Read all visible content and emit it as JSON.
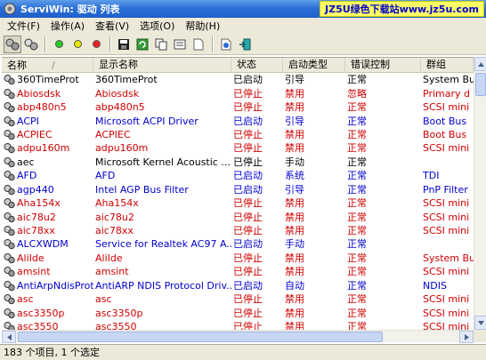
{
  "window": {
    "title": "ServiWin: 驱动 列表",
    "watermark": "JZ5U绿色下载站www.jz5u.com"
  },
  "menu": [
    "文件(F)",
    "操作(A)",
    "查看(V)",
    "选项(O)",
    "帮助(H)"
  ],
  "toolbar": {
    "buttons": [
      {
        "name": "drivers-view-icon",
        "pressed": true
      },
      {
        "name": "services-view-icon",
        "pressed": false
      },
      {
        "name": "sep"
      },
      {
        "name": "start-green-icon",
        "color": "#22cc22"
      },
      {
        "name": "pause-yellow-icon",
        "color": "#e8e800"
      },
      {
        "name": "stop-red-icon",
        "color": "#ee2222"
      },
      {
        "name": "sep"
      },
      {
        "name": "save-icon"
      },
      {
        "name": "refresh-icon"
      },
      {
        "name": "copy-icon"
      },
      {
        "name": "properties-icon"
      },
      {
        "name": "blank-page-icon"
      },
      {
        "name": "sep"
      },
      {
        "name": "html-report-icon"
      },
      {
        "name": "exit-icon"
      }
    ]
  },
  "columns": [
    "名称",
    "显示名称",
    "状态",
    "启动类型",
    "错误控制",
    "群组"
  ],
  "colors": {
    "red": "#d00000",
    "blue": "#0000d0",
    "black": "#000000"
  },
  "rows": [
    {
      "name": "360TimeProt",
      "display": "360TimeProt",
      "status": "已启动",
      "start": "引导",
      "error": "正常",
      "group": "System Bu",
      "color": "black"
    },
    {
      "name": "Abiosdsk",
      "display": "Abiosdsk",
      "status": "已停止",
      "start": "禁用",
      "error": "忽略",
      "group": "Primary d",
      "color": "red"
    },
    {
      "name": "abp480n5",
      "display": "abp480n5",
      "status": "已停止",
      "start": "禁用",
      "error": "正常",
      "group": "SCSI mini",
      "color": "red"
    },
    {
      "name": "ACPI",
      "display": "Microsoft ACPI Driver",
      "status": "已启动",
      "start": "引导",
      "error": "正常",
      "group": "Boot Bus",
      "color": "blue"
    },
    {
      "name": "ACPIEC",
      "display": "ACPIEC",
      "status": "已停止",
      "start": "禁用",
      "error": "正常",
      "group": "Boot Bus",
      "color": "red"
    },
    {
      "name": "adpu160m",
      "display": "adpu160m",
      "status": "已停止",
      "start": "禁用",
      "error": "正常",
      "group": "SCSI mini",
      "color": "red"
    },
    {
      "name": "aec",
      "display": "Microsoft Kernel Acoustic ...",
      "status": "已停止",
      "start": "手动",
      "error": "正常",
      "group": "",
      "color": "black"
    },
    {
      "name": "AFD",
      "display": "AFD",
      "status": "已启动",
      "start": "系统",
      "error": "正常",
      "group": "TDI",
      "color": "blue"
    },
    {
      "name": "agp440",
      "display": "Intel AGP Bus Filter",
      "status": "已启动",
      "start": "引导",
      "error": "正常",
      "group": "PnP Filter",
      "color": "blue"
    },
    {
      "name": "Aha154x",
      "display": "Aha154x",
      "status": "已停止",
      "start": "禁用",
      "error": "正常",
      "group": "SCSI mini",
      "color": "red"
    },
    {
      "name": "aic78u2",
      "display": "aic78u2",
      "status": "已停止",
      "start": "禁用",
      "error": "正常",
      "group": "SCSI mini",
      "color": "red"
    },
    {
      "name": "aic78xx",
      "display": "aic78xx",
      "status": "已停止",
      "start": "禁用",
      "error": "正常",
      "group": "SCSI mini",
      "color": "red"
    },
    {
      "name": "ALCXWDM",
      "display": "Service for Realtek AC97 A...",
      "status": "已启动",
      "start": "手动",
      "error": "正常",
      "group": "",
      "color": "blue"
    },
    {
      "name": "AliIde",
      "display": "AliIde",
      "status": "已停止",
      "start": "禁用",
      "error": "正常",
      "group": "System Bu",
      "color": "red"
    },
    {
      "name": "amsint",
      "display": "amsint",
      "status": "已停止",
      "start": "禁用",
      "error": "正常",
      "group": "SCSI mini",
      "color": "red"
    },
    {
      "name": "AntiArpNdisProt",
      "display": "AntiARP NDIS Protocol Driv...",
      "status": "已启动",
      "start": "自动",
      "error": "正常",
      "group": "NDIS",
      "color": "blue"
    },
    {
      "name": "asc",
      "display": "asc",
      "status": "已停止",
      "start": "禁用",
      "error": "正常",
      "group": "SCSI mini",
      "color": "red"
    },
    {
      "name": "asc3350p",
      "display": "asc3350p",
      "status": "已停止",
      "start": "禁用",
      "error": "正常",
      "group": "SCSI mini",
      "color": "red"
    },
    {
      "name": "asc3550",
      "display": "asc3550",
      "status": "已停止",
      "start": "禁用",
      "error": "正常",
      "group": "SCSI mini",
      "color": "red"
    }
  ],
  "status": {
    "text": "183 个项目, 1 个选定"
  }
}
